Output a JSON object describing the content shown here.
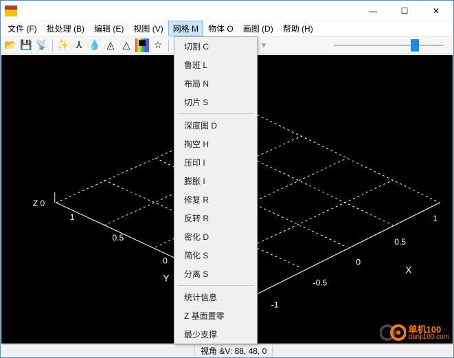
{
  "titlebar": {
    "buttons": {
      "min": "—",
      "max": "☐",
      "close": "✕"
    }
  },
  "menubar": {
    "items": [
      {
        "label": "文件 (F)",
        "name": "menu-file"
      },
      {
        "label": "批处理 (B)",
        "name": "menu-batch"
      },
      {
        "label": "编辑 (E)",
        "name": "menu-edit"
      },
      {
        "label": "视图 (V)",
        "name": "menu-view"
      },
      {
        "label": "网格 M",
        "name": "menu-mesh",
        "open": true
      },
      {
        "label": "物体 O",
        "name": "menu-object"
      },
      {
        "label": "画图 (D)",
        "name": "menu-draw"
      },
      {
        "label": "帮助 (H)",
        "name": "menu-help"
      }
    ]
  },
  "toolbar": {
    "groups": [
      [
        "open-icon",
        "save-icon",
        "transmit-icon"
      ],
      [
        "spark-icon",
        "branch-icon",
        "drip-icon",
        "prism-icon",
        "cone-icon",
        "rainbow-icon",
        "star-icon"
      ],
      [
        "info-icon",
        "info2-icon"
      ],
      [
        "undo-icon",
        "undo-dd-icon",
        "redo-icon",
        "redo-dd-icon"
      ]
    ],
    "glyphs": {
      "open-icon": "📂",
      "save-icon": "💾",
      "transmit-icon": "📡",
      "spark-icon": "✨",
      "branch-icon": "⅄",
      "drip-icon": "💧",
      "prism-icon": "◬",
      "cone-icon": "△",
      "rainbow-icon": "▀",
      "star-icon": "☆",
      "info-icon": "ⓘ",
      "info2-icon": "ⓘ",
      "undo-icon": "↶",
      "undo-dd-icon": "▾",
      "redo-icon": "↷",
      "redo-dd-icon": "▾"
    }
  },
  "dropdown": {
    "groups": [
      [
        "切割 C",
        "鲁班 L",
        "布局 N",
        "切片 S"
      ],
      [
        "深度图 D",
        "掏空 H",
        "压印 I",
        "膨胀 I",
        "修复 R",
        "反转 R",
        "密化 D",
        "简化 S",
        "分离 S"
      ],
      [
        "统计信息",
        "Z 基面置零",
        "最少支撑"
      ]
    ]
  },
  "viewport": {
    "axes": {
      "x_label": "X",
      "y_label": "Y",
      "z_label": "Z"
    },
    "ticks": {
      "neg1": "-1",
      "neg05": "-0.5",
      "zero": "0",
      "pos05": "0.5",
      "pos1": "1",
      "z0": "0"
    }
  },
  "statusbar": {
    "cell0": "",
    "cell1": "视角 &V: 88, 48, 0"
  },
  "watermark": {
    "cn": "单机100",
    "url": "danji100.com"
  }
}
